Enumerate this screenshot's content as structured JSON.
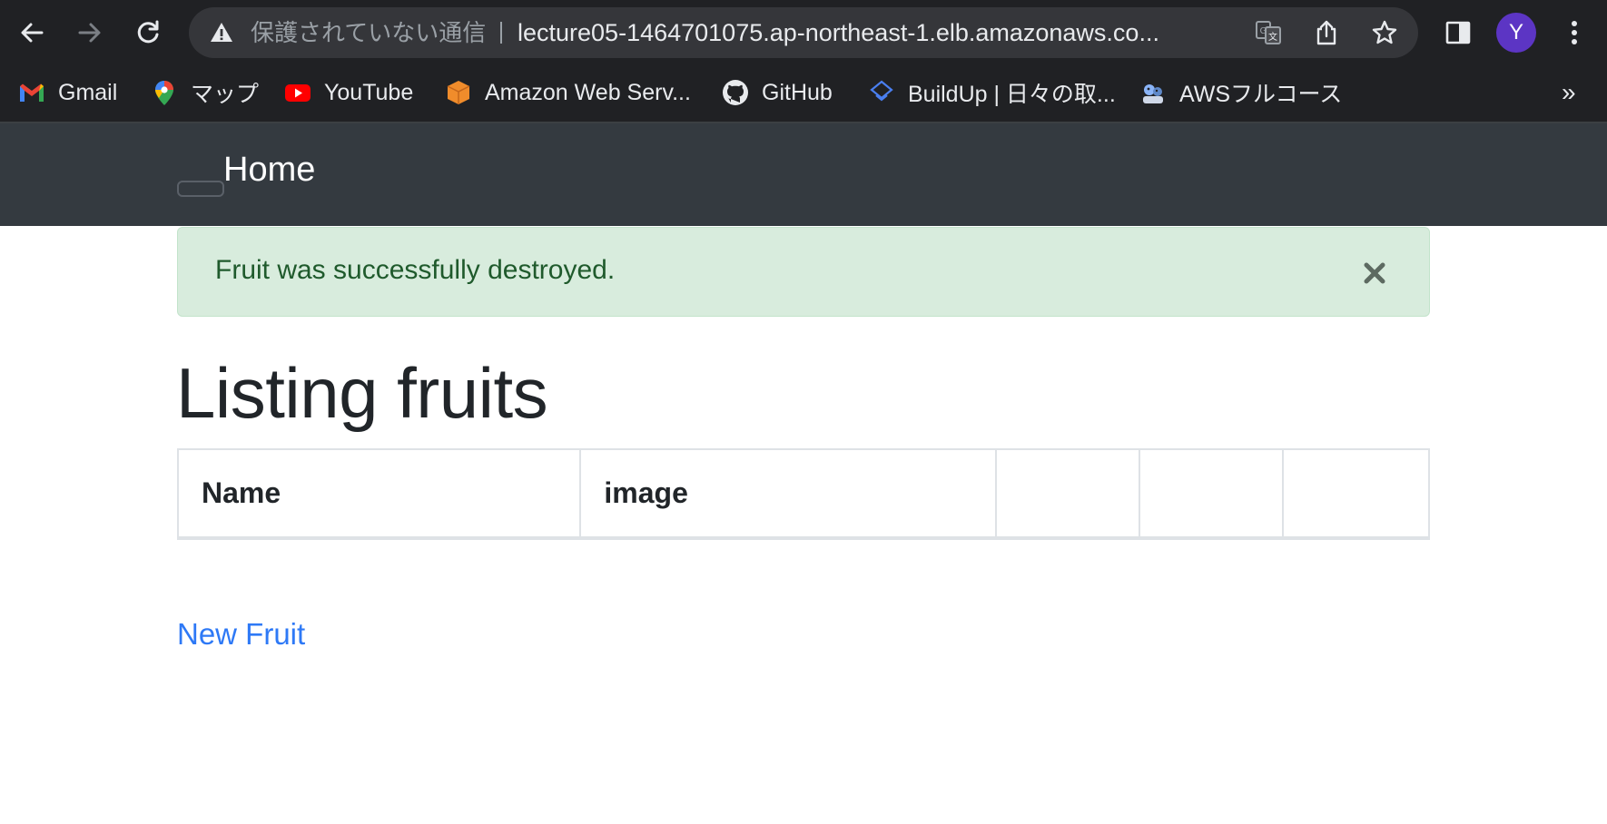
{
  "browser": {
    "security_label": "保護されていない通信",
    "url": "lecture05-1464701075.ap-northeast-1.elb.amazonaws.co...",
    "profile_initial": "Y",
    "colors": {
      "toolbar_bg": "#202124",
      "omnibox_bg": "#35363a",
      "avatar_bg": "#5c35c4"
    }
  },
  "bookmarks": {
    "items": [
      {
        "label": "Gmail",
        "icon": "gmail-icon"
      },
      {
        "label": "マップ",
        "icon": "maps-icon"
      },
      {
        "label": "YouTube",
        "icon": "youtube-icon"
      },
      {
        "label": "Amazon Web Serv...",
        "icon": "aws-icon"
      },
      {
        "label": "GitHub",
        "icon": "github-icon"
      },
      {
        "label": "BuildUp | 日々の取...",
        "icon": "buildup-icon"
      },
      {
        "label": "AWSフルコース",
        "icon": "aws-course-icon"
      }
    ],
    "overflow": "»"
  },
  "navbar": {
    "brand": "Home"
  },
  "alert": {
    "message": "Fruit was successfully destroyed.",
    "color": "#d8ecdd"
  },
  "page": {
    "title": "Listing fruits",
    "table": {
      "headers": [
        "Name",
        "image",
        "",
        "",
        ""
      ]
    },
    "new_link": "New Fruit",
    "link_color": "#2e79f6"
  }
}
